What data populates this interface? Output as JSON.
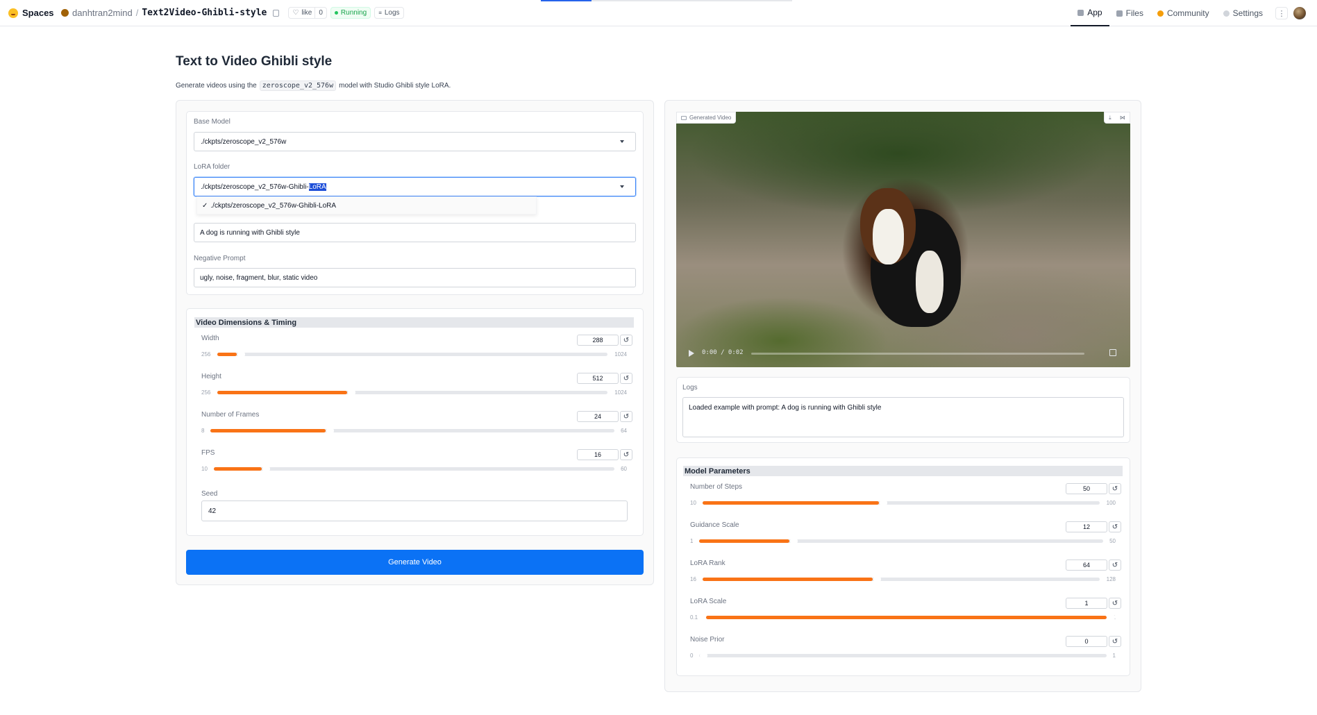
{
  "topbar": {
    "brand": "Spaces",
    "owner": "danhtran2mind",
    "separator": "/",
    "repo": "Text2Video-Ghibli-style",
    "like_label": "like",
    "like_count": "0",
    "status": "Running",
    "logs_label": "Logs",
    "nav": [
      {
        "label": "App",
        "icon": "app-icon"
      },
      {
        "label": "Files",
        "icon": "files-icon"
      },
      {
        "label": "Community",
        "icon": "community-icon"
      },
      {
        "label": "Settings",
        "icon": "gear-icon"
      }
    ],
    "kebab": "⋮"
  },
  "page": {
    "title": "Text to Video Ghibli style",
    "desc_before": "Generate videos using the",
    "desc_code": "zeroscope_v2_576w",
    "desc_after": "model with Studio Ghibli style LoRA."
  },
  "inputs": {
    "base_model_label": "Base Model",
    "base_model_value": "./ckpts/zeroscope_v2_576w",
    "lora_folder_label": "LoRA folder",
    "lora_folder_value_plain": "./ckpts/zeroscope_v2_576w-Ghibli-",
    "lora_folder_value_selected": "LoRA",
    "dropdown_check": "✓",
    "dropdown_option": "./ckpts/zeroscope_v2_576w-Ghibli-LoRA",
    "prompt_value": "A dog is running with Ghibli style",
    "negative_label": "Negative Prompt",
    "negative_value": "ugly, noise, fragment, blur, static video"
  },
  "dimensions": {
    "title": "Video Dimensions & Timing",
    "sliders": [
      {
        "name": "Width",
        "value": "288",
        "min": "256",
        "max": "1024",
        "frac": 0.042
      },
      {
        "name": "Height",
        "value": "512",
        "min": "256",
        "max": "1024",
        "frac": 0.333
      },
      {
        "name": "Number of Frames",
        "value": "24",
        "min": "8",
        "max": "64",
        "frac": 0.286
      },
      {
        "name": "FPS",
        "value": "16",
        "min": "10",
        "max": "60",
        "frac": 0.12
      }
    ],
    "seed_label": "Seed",
    "seed_value": "42"
  },
  "generate_label": "Generate Video",
  "output": {
    "video_label": "Generated Video",
    "time": "0:00 / 0:02",
    "logs_label": "Logs",
    "logs_text": "Loaded example with prompt: A dog is running with Ghibli style"
  },
  "model_params": {
    "title": "Model Parameters",
    "sliders": [
      {
        "name": "Number of Steps",
        "value": "50",
        "min": "10",
        "max": "100",
        "frac": 0.444
      },
      {
        "name": "Guidance Scale",
        "value": "12",
        "min": "1",
        "max": "50",
        "frac": 0.224
      },
      {
        "name": "LoRA Rank",
        "value": "64",
        "min": "16",
        "max": "128",
        "frac": 0.429
      },
      {
        "name": "LoRA Scale",
        "value": "1",
        "min": "0.1",
        "max": "1",
        "frac": 1.0
      },
      {
        "name": "Noise Prior",
        "value": "0",
        "min": "0",
        "max": "1",
        "frac": 0.0
      }
    ]
  },
  "colors": {
    "accent": "#f97316",
    "primary_button": "#0b72f5",
    "running": "#16a34a"
  },
  "reset_glyph": "↺"
}
